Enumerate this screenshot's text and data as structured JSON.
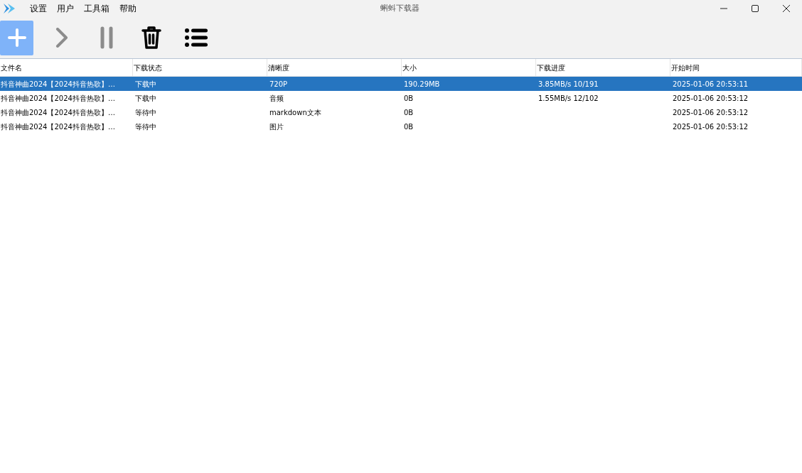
{
  "window": {
    "title": "蝌蚪下载器"
  },
  "menu": [
    "设置",
    "用户",
    "工具箱",
    "帮助"
  ],
  "toolbar": [
    {
      "kind": "add",
      "highlighted": true,
      "disabled": false
    },
    {
      "kind": "start",
      "highlighted": false,
      "disabled": true
    },
    {
      "kind": "pause",
      "highlighted": false,
      "disabled": true
    },
    {
      "kind": "delete",
      "highlighted": false,
      "disabled": false
    },
    {
      "kind": "list",
      "highlighted": false,
      "disabled": false
    }
  ],
  "table": {
    "columns": [
      "文件名",
      "下载状态",
      "清晰度",
      "大小",
      "下载进度",
      "开始时间"
    ],
    "rows": [
      {
        "selected": true,
        "cells": [
          "抖音神曲2024【2024抖音热歌】…",
          "下载中",
          "720P",
          "190.29MB",
          "3.85MB/s 10/191",
          "2025-01-06 20:53:11"
        ]
      },
      {
        "selected": false,
        "cells": [
          "抖音神曲2024【2024抖音热歌】…",
          "下载中",
          "音频",
          "0B",
          "1.55MB/s 12/102",
          "2025-01-06 20:53:12"
        ]
      },
      {
        "selected": false,
        "cells": [
          "抖音神曲2024【2024抖音热歌】…",
          "等待中",
          "markdown文本",
          "0B",
          "",
          "2025-01-06 20:53:12"
        ]
      },
      {
        "selected": false,
        "cells": [
          "抖音神曲2024【2024抖音热歌】…",
          "等待中",
          "图片",
          "0B",
          "",
          "2025-01-06 20:53:12"
        ]
      }
    ]
  }
}
